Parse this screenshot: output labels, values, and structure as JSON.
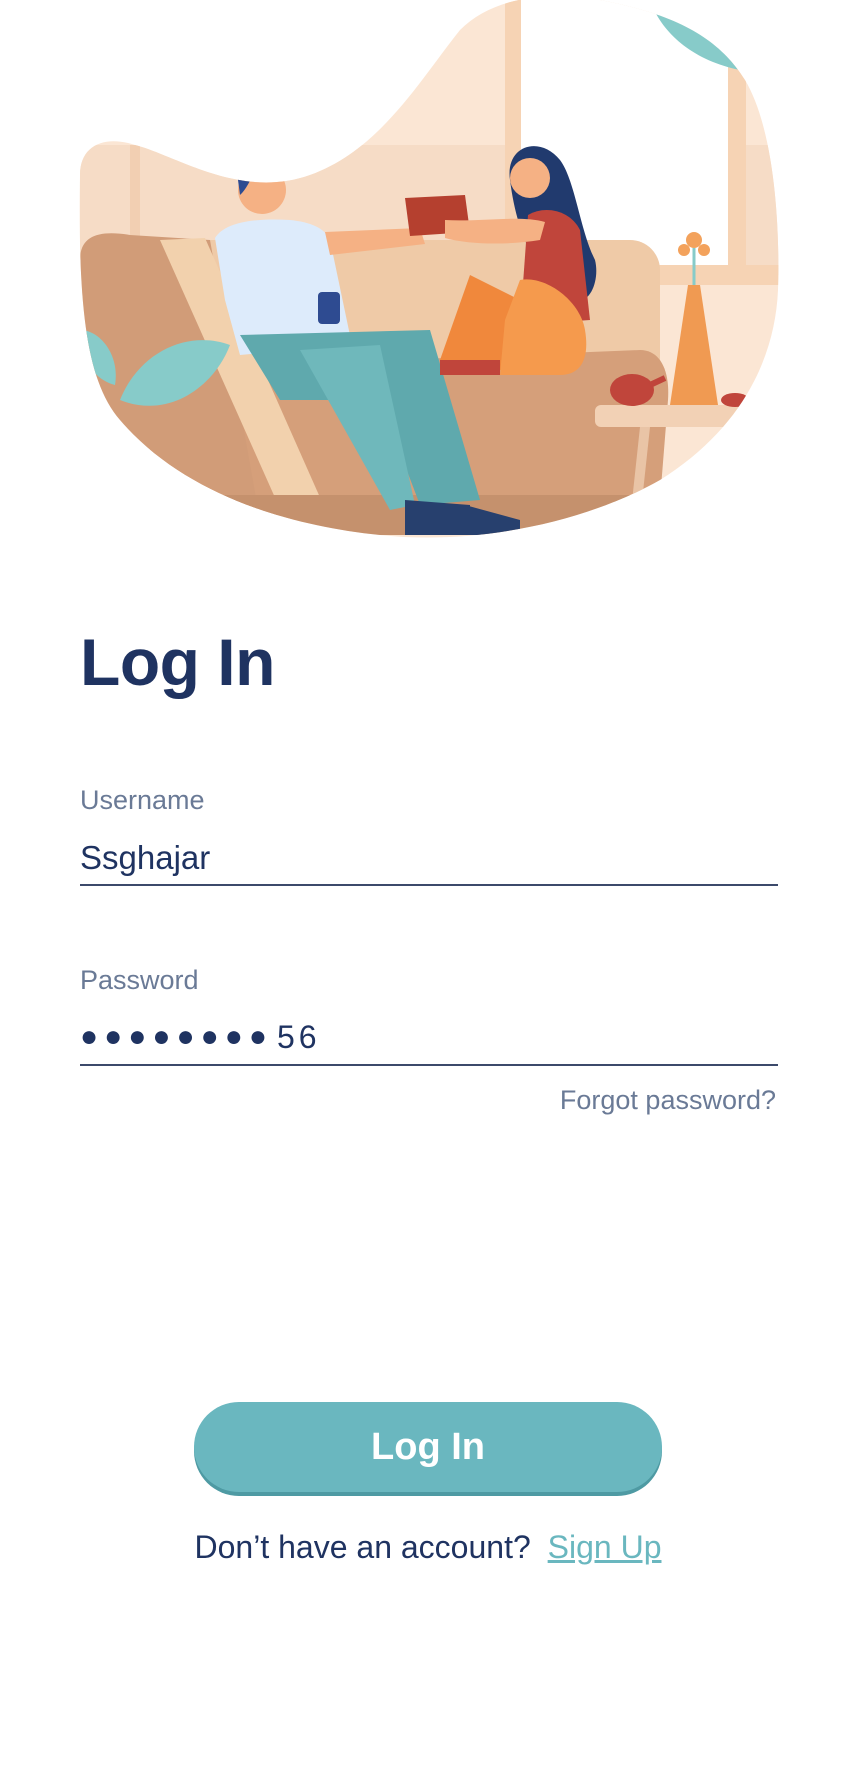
{
  "header": {
    "title": "Log In"
  },
  "form": {
    "username": {
      "label": "Username",
      "value": "Ssghajar"
    },
    "password": {
      "label": "Password",
      "masked_part": "●●●●●●●●",
      "visible_part": "56"
    },
    "forgot_password_label": "Forgot password?"
  },
  "actions": {
    "login_button_label": "Log In",
    "signup_prompt": "Don’t have an account?",
    "signup_link_label": "Sign Up"
  },
  "colors": {
    "primary_text": "#1f3361",
    "secondary_text": "#6a7a96",
    "accent": "#6ab7bf",
    "input_underline": "#3c4a6b"
  },
  "illustration": {
    "icon": "couple-on-sofa-illustration"
  }
}
